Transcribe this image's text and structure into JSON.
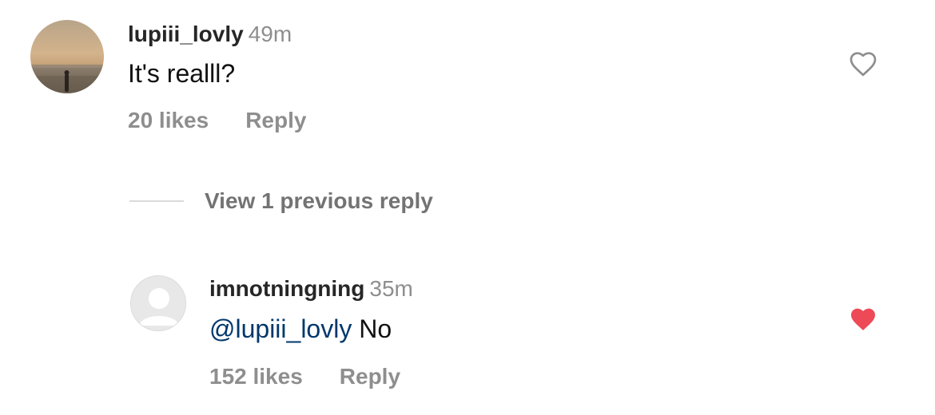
{
  "comment": {
    "username": "lupiii_lovly",
    "time": "49m",
    "text": "It's realll?",
    "likes": "20 likes",
    "reply_label": "Reply",
    "liked": false,
    "avatar_icon": "sunset-beach-photo-avatar"
  },
  "view_replies": {
    "label": "View 1 previous reply"
  },
  "reply": {
    "username": "imnotningning",
    "time": "35m",
    "mention": "@lupiii_lovly",
    "text": " No",
    "likes": "152 likes",
    "reply_label": "Reply",
    "liked": true,
    "avatar_icon": "default-user-avatar"
  },
  "colors": {
    "username": "#262626",
    "secondary": "#8e8e8e",
    "mention": "#00376b",
    "heart_liked": "#ed4956",
    "heart_outline": "#8e8e8e",
    "divider": "#dbdbdb"
  },
  "icons": {
    "heart_outline": "heart-outline-icon",
    "heart_filled": "heart-filled-icon"
  }
}
